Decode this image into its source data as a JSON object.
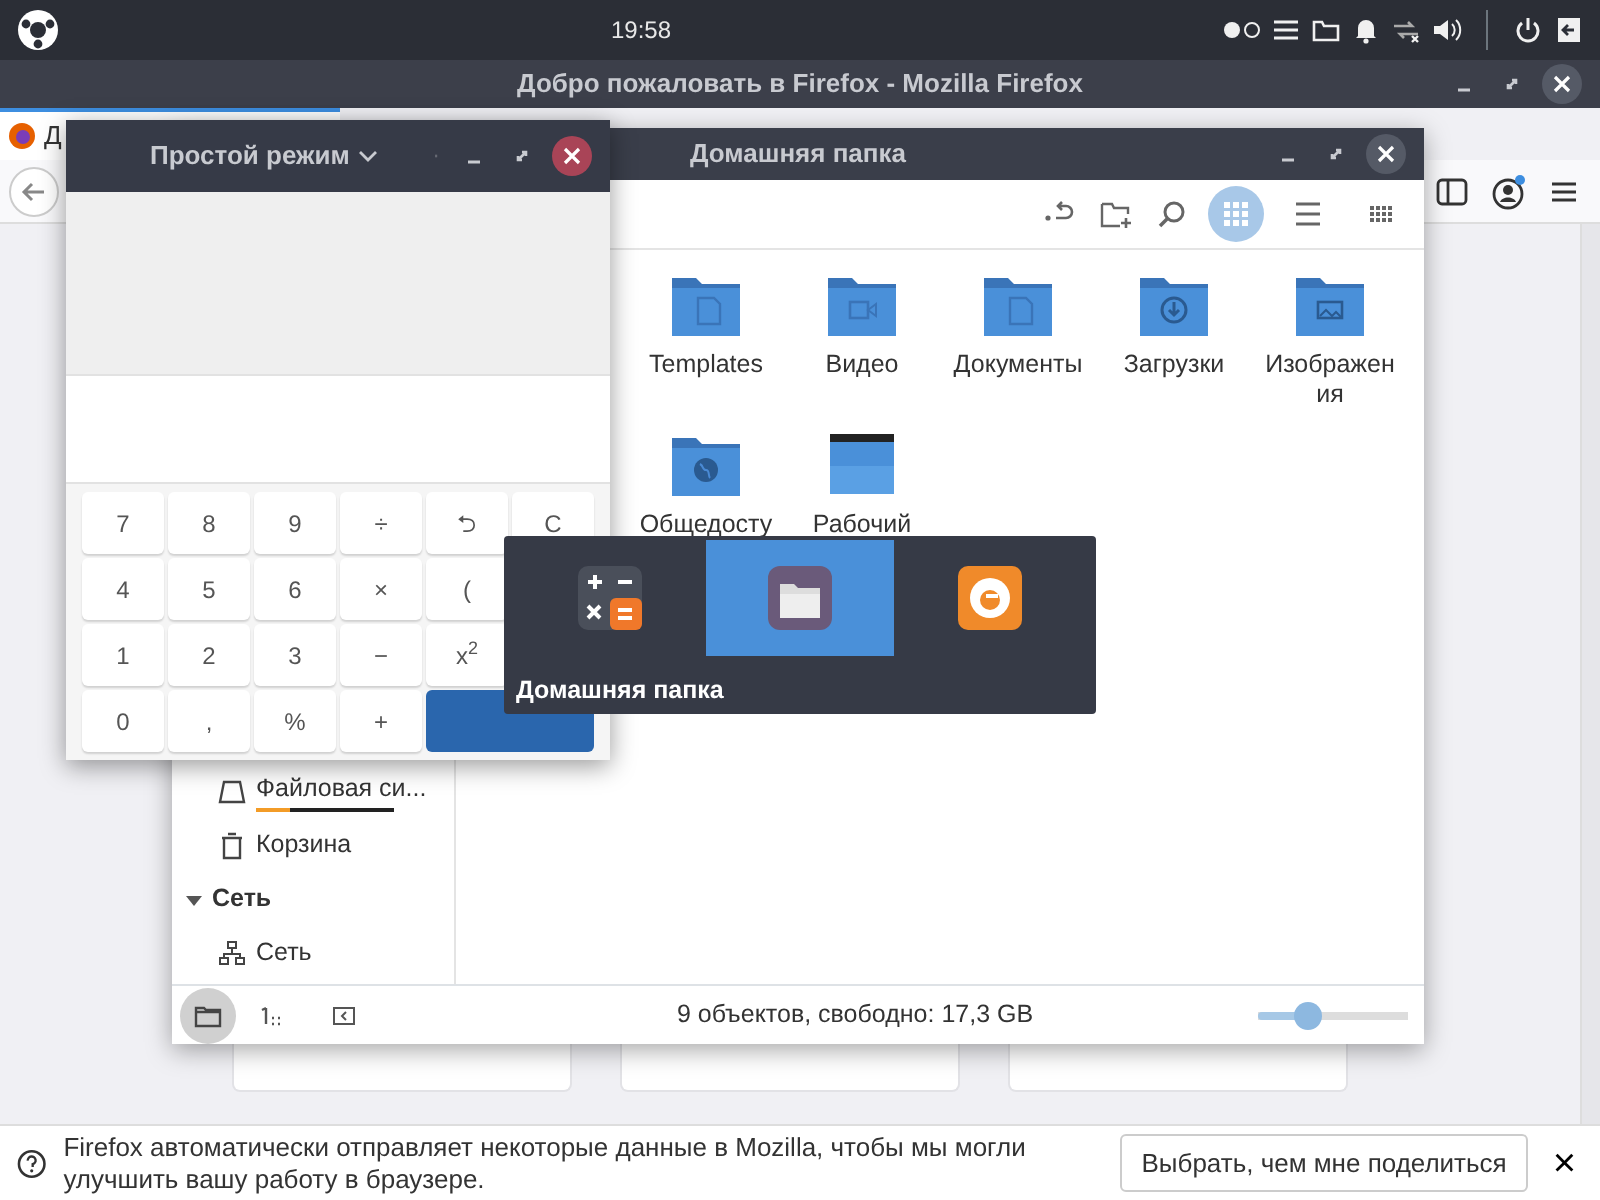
{
  "top_panel": {
    "clock": "19:58"
  },
  "firefox": {
    "title": "Добро пожаловать в Firefox - Mozilla Firefox",
    "tab": {
      "label": "Д"
    },
    "notification": {
      "text": "Firefox автоматически отправляет некоторые данные в Mozilla, чтобы мы могли улучшить вашу работу в браузере.",
      "button": "Выбрать, чем мне поделиться",
      "close": "×"
    }
  },
  "files": {
    "title": "Домашняя папка",
    "view_modes": [
      {
        "kind": "icons",
        "selected": true
      },
      {
        "kind": "list",
        "selected": false
      },
      {
        "kind": "compact",
        "selected": false
      }
    ],
    "folders": [
      {
        "kind": "templates",
        "label": "Templates"
      },
      {
        "kind": "video",
        "label": "Видео"
      },
      {
        "kind": "documents",
        "label": "Документы"
      },
      {
        "kind": "downloads",
        "label": "Загрузки"
      },
      {
        "kind": "pictures",
        "label": "Изображения"
      },
      {
        "kind": "public",
        "label": "Общедосту"
      },
      {
        "kind": "desktop",
        "label": "Рабочий"
      }
    ],
    "sidebar": [
      {
        "kind": "drive",
        "label": "Файловая си...",
        "level": 0.25
      },
      {
        "kind": "trash",
        "label": "Корзина"
      },
      {
        "kind": "header",
        "label": "Сеть",
        "expanded": true
      },
      {
        "kind": "network",
        "label": "Сеть"
      }
    ],
    "status": "9 объектов, свободно: 17,3 GB",
    "zoom": {
      "level": 0.3
    }
  },
  "calculator": {
    "mode": "Простой режим",
    "keys": [
      {
        "label": "7"
      },
      {
        "label": "8"
      },
      {
        "label": "9"
      },
      {
        "label": "÷"
      },
      {
        "label": "⮌"
      },
      {
        "label": "C"
      },
      {
        "label": "4"
      },
      {
        "label": "5"
      },
      {
        "label": "6"
      },
      {
        "label": "×"
      },
      {
        "label": "("
      },
      {
        "kind": "hidden"
      },
      {
        "label": "1"
      },
      {
        "label": "2"
      },
      {
        "label": "3"
      },
      {
        "label": "−"
      },
      {
        "label": "x$^{2}$"
      },
      {
        "kind": "hidden"
      },
      {
        "label": "0"
      },
      {
        "label": ","
      },
      {
        "label": "%"
      },
      {
        "label": "+"
      },
      {
        "kind": "equals"
      }
    ]
  },
  "switcher": {
    "label": "Домашняя папка",
    "apps": [
      {
        "kind": "calculator",
        "selected": false
      },
      {
        "kind": "files",
        "selected": true
      },
      {
        "kind": "firefox",
        "selected": false
      }
    ]
  }
}
